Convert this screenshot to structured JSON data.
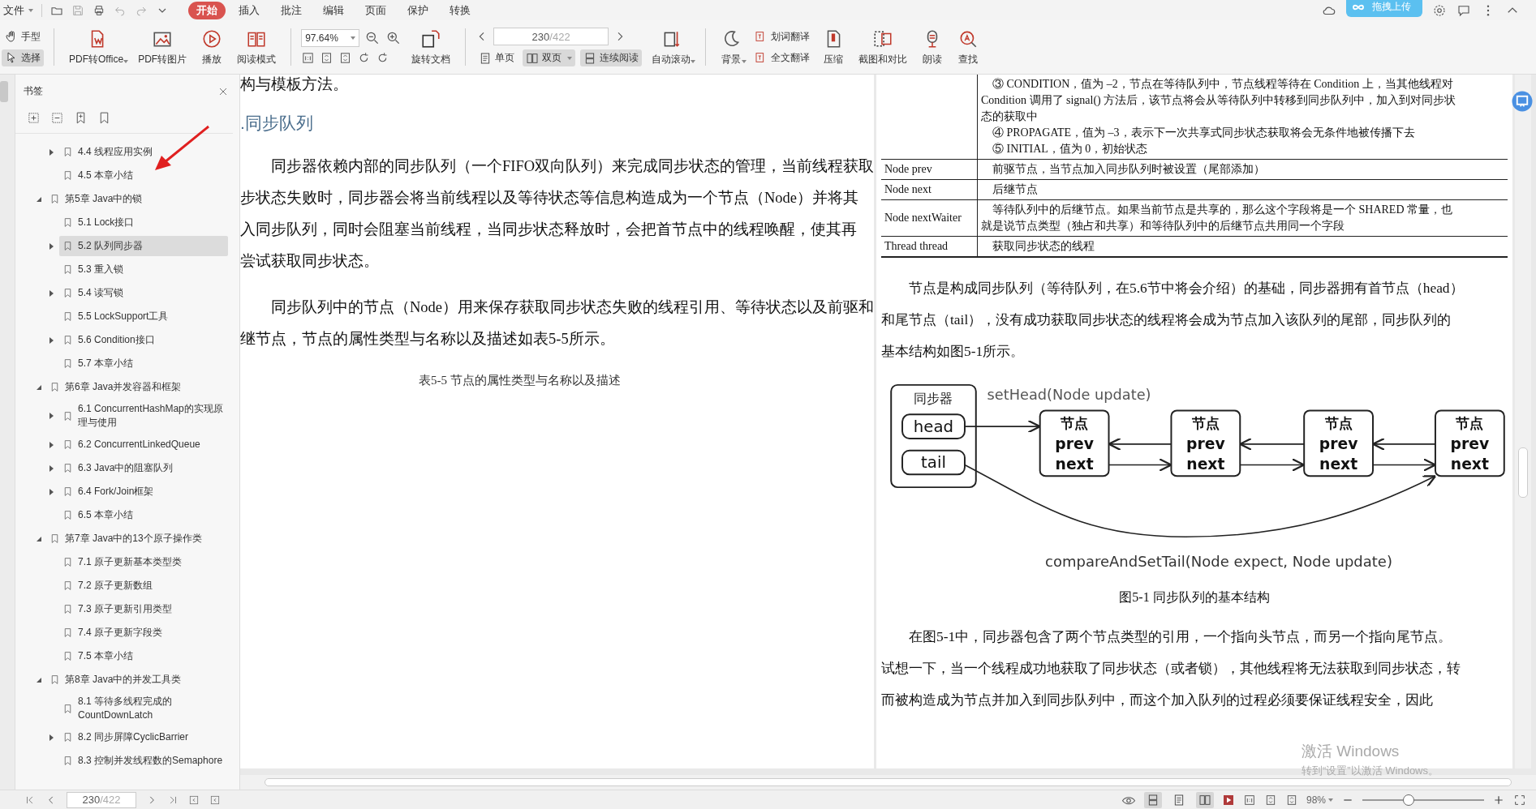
{
  "menu_bar": {
    "file_menu": "文件",
    "ribbon_tabs": [
      {
        "label": "开始",
        "selected": true
      },
      {
        "label": "插入",
        "selected": false
      },
      {
        "label": "批注",
        "selected": false
      },
      {
        "label": "编辑",
        "selected": false
      },
      {
        "label": "页面",
        "selected": false
      },
      {
        "label": "保护",
        "selected": false
      },
      {
        "label": "转换",
        "selected": false
      }
    ],
    "upload_badge": "拖拽上传"
  },
  "toolbar": {
    "pointer_modes": [
      {
        "label": "手型",
        "selected": false
      },
      {
        "label": "选择",
        "selected": true
      }
    ],
    "convert_tools": [
      {
        "label": "PDF转Office",
        "dropdown": true
      },
      {
        "label": "PDF转图片",
        "dropdown": false
      },
      {
        "label": "播放",
        "dropdown": false
      },
      {
        "label": "阅读模式",
        "dropdown": false
      }
    ],
    "zoom": "97.64%",
    "rotate": "旋转文档",
    "page_current": "230",
    "page_total": "/422",
    "view_modes": [
      {
        "label": "单页",
        "selected": false,
        "dropdown": false
      },
      {
        "label": "双页",
        "selected": true,
        "dropdown": true
      },
      {
        "label": "连续阅读",
        "selected": true,
        "dropdown": false
      }
    ],
    "tools": [
      {
        "label": "自动滚动",
        "dropdown": true
      },
      {
        "label": "背景",
        "dropdown": true
      }
    ],
    "translate": [
      "划词翻译",
      "全文翻译"
    ],
    "more_tools": [
      "压缩",
      "截图和对比",
      "朗读",
      "查找"
    ]
  },
  "sidebar": {
    "title": "书签",
    "items": [
      {
        "children": [
          {
            "label": "4.4 线程应用实例",
            "collapsed": true,
            "selected": false
          },
          {
            "label": "4.5 本章小结",
            "collapsed": false,
            "selected": false
          }
        ]
      },
      {
        "label": "第5章 Java中的锁",
        "selected": false,
        "children": [
          {
            "label": "5.1 Lock接口",
            "collapsed": false,
            "selected": false
          },
          {
            "label": "5.2 队列同步器",
            "collapsed": true,
            "selected": true
          },
          {
            "label": "5.3 重入锁",
            "collapsed": false,
            "selected": false
          },
          {
            "label": "5.4 读写锁",
            "collapsed": true,
            "selected": false
          },
          {
            "label": "5.5 LockSupport工具",
            "collapsed": false,
            "selected": false
          },
          {
            "label": "5.6 Condition接口",
            "collapsed": true,
            "selected": false
          },
          {
            "label": "5.7 本章小结",
            "collapsed": false,
            "selected": false
          }
        ]
      },
      {
        "label": "第6章 Java并发容器和框架",
        "selected": false,
        "children": [
          {
            "label": "6.1 ConcurrentHashMap的实现原理与使用",
            "collapsed": true,
            "selected": false
          },
          {
            "label": "6.2 ConcurrentLinkedQueue",
            "collapsed": true,
            "selected": false
          },
          {
            "label": "6.3 Java中的阻塞队列",
            "collapsed": true,
            "selected": false
          },
          {
            "label": "6.4 Fork/Join框架",
            "collapsed": true,
            "selected": false
          },
          {
            "label": "6.5 本章小结",
            "collapsed": false,
            "selected": false
          }
        ]
      },
      {
        "label": "第7章 Java中的13个原子操作类",
        "selected": false,
        "children": [
          {
            "label": "7.1 原子更新基本类型类",
            "collapsed": false,
            "selected": false
          },
          {
            "label": "7.2 原子更新数组",
            "collapsed": false,
            "selected": false
          },
          {
            "label": "7.3 原子更新引用类型",
            "collapsed": false,
            "selected": false
          },
          {
            "label": "7.4 原子更新字段类",
            "collapsed": false,
            "selected": false
          },
          {
            "label": "7.5 本章小结",
            "collapsed": false,
            "selected": false
          }
        ]
      },
      {
        "label": "第8章 Java中的并发工具类",
        "selected": false,
        "children": [
          {
            "label": "8.1 等待多线程完成的CountDownLatch",
            "collapsed": false,
            "selected": false
          },
          {
            "label": "8.2 同步屏障CyclicBarrier",
            "collapsed": true,
            "selected": false
          },
          {
            "label": "8.3 控制并发线程数的Semaphore",
            "collapsed": false,
            "selected": false
          }
        ]
      }
    ],
    "page_current": "230",
    "page_total": "/422"
  },
  "left_page": {
    "top_line": "构与模板方法。",
    "heading": ".同步队列",
    "paragraphs": [
      [
        "　　同步器依赖内部的同步队列（一个FIFO双向队列）来完成同步状态的管理，当前线程获取",
        "步状态失败时，同步器会将当前线程以及等待状态等信息构造成为一个节点（Node）并将其",
        "入同步队列，同时会阻塞当前线程，当同步状态释放时，会把首节点中的线程唤醒，使其再",
        "尝试获取同步状态。"
      ],
      [
        "　　同步队列中的节点（Node）用来保存获取同步状态失败的线程引用、等待状态以及前驱和",
        "继节点，节点的属性类型与名称以及描述如表5-5所示。"
      ]
    ],
    "table_caption": "表5-5  节点的属性类型与名称以及描述"
  },
  "right_page": {
    "table_rows": [
      {
        "name": "",
        "description": [
          "　③ CONDITION，值为 –2，节点在等待队列中，节点线程等待在 Condition 上，当其他线程对",
          "Condition 调用了 signal() 方法后，该节点将会从等待队列中转移到同步队列中，加入到对同步状",
          "态的获取中",
          "　④ PROPAGATE，值为 –3，表示下一次共享式同步状态获取将会无条件地被传播下去",
          "　⑤ INITIAL，值为 0，初始状态"
        ]
      },
      {
        "name": "Node prev",
        "description": [
          "　前驱节点，当节点加入同步队列时被设置（尾部添加）"
        ]
      },
      {
        "name": "Node next",
        "description": [
          "　后继节点"
        ]
      },
      {
        "name": "Node nextWaiter",
        "description": [
          "　等待队列中的后继节点。如果当前节点是共享的，那么这个字段将是一个 SHARED 常量，也",
          "就是说节点类型（独占和共享）和等待队列中的后继节点共用同一个字段"
        ]
      },
      {
        "name": "Thread thread",
        "description": [
          "　获取同步状态的线程"
        ]
      }
    ],
    "paragraph_1": [
      "　　节点是构成同步队列（等待队列，在5.6节中将会介绍）的基础，同步器拥有首节点（head）",
      "和尾节点（tail），没有成功获取同步状态的线程将会成为节点加入该队列的尾部，同步队列的",
      "基本结构如图5-1所示。"
    ],
    "figure": {
      "container_label": "同步器",
      "head": "head",
      "tail": "tail",
      "set_head": "setHead(Node update)",
      "nodes": [
        {
          "title": "节点",
          "prev": "prev",
          "next": "next"
        },
        {
          "title": "节点",
          "prev": "prev",
          "next": "next"
        },
        {
          "title": "节点",
          "prev": "prev",
          "next": "next"
        },
        {
          "title": "节点",
          "prev": "prev",
          "next": "next"
        }
      ],
      "cas_label": "compareAndSetTail(Node expect, Node update)",
      "caption": "图5-1   同步队列的基本结构"
    },
    "paragraph_2": [
      "　　在图5-1中，同步器包含了两个节点类型的引用，一个指向头节点，而另一个指向尾节点。",
      "试想一下，当一个线程成功地获取了同步状态（或者锁），其他线程将无法获取到同步状态，转",
      "而被构造成为节点并加入到同步队列中，而这个加入队列的过程必须要保证线程安全，因此"
    ]
  },
  "activation_notice": {
    "title": "激活 Windows",
    "hint": "转到“设置”以激活 Windows。"
  },
  "status_bar": {
    "view_modes": [
      {
        "selected": true
      },
      {
        "selected": false
      },
      {
        "selected": true
      }
    ],
    "zoom": "98%",
    "zoom_slider": {
      "level": 0.37
    }
  }
}
